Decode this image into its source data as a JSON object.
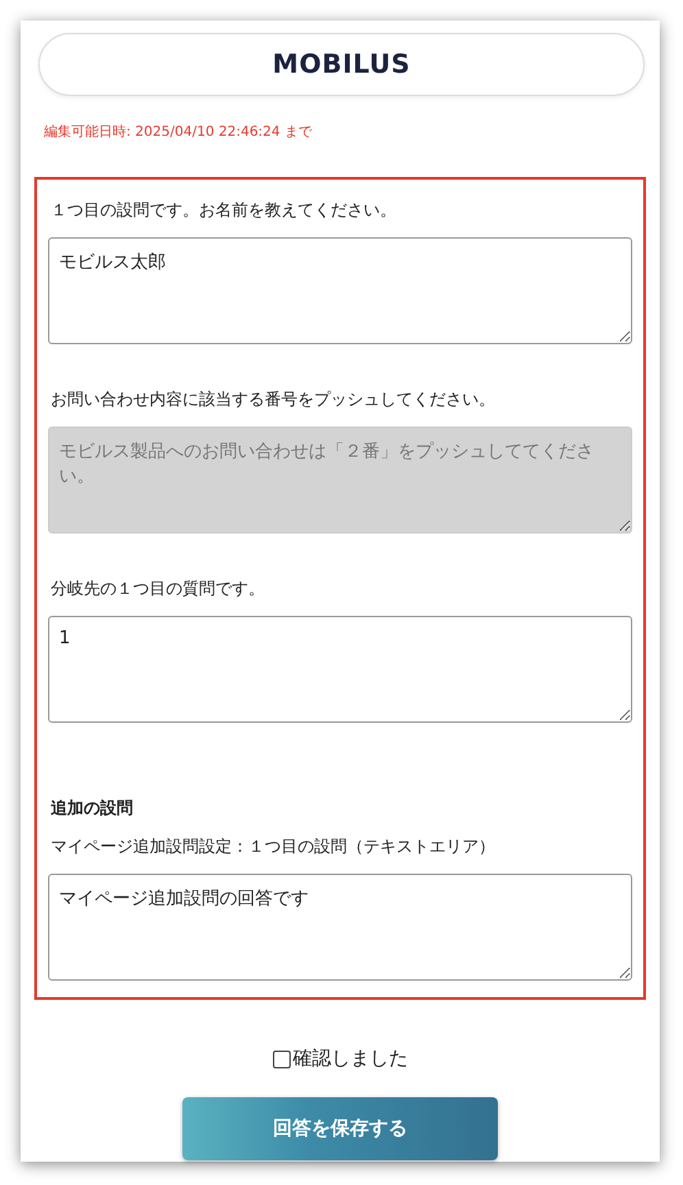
{
  "logo": "MOBILUS",
  "deadline": "編集可能日時: 2025/04/10 22:46:24 まで",
  "questions": [
    {
      "label": "１つ目の設問です。お名前を教えてください。",
      "value": "モビルス太郎",
      "disabled": false
    },
    {
      "label": "お問い合わせ内容に該当する番号をプッシュしてください。",
      "value": "モビルス製品へのお問い合わせは「２番」をプッシュしててください。",
      "disabled": true
    },
    {
      "label": "分岐先の１つ目の質問です。",
      "value": "1",
      "disabled": false
    }
  ],
  "additional": {
    "heading": "追加の設問",
    "label": "マイページ追加設問設定：１つ目の設問（テキストエリア）",
    "value": "マイページ追加設問の回答です",
    "disabled": false
  },
  "confirm": {
    "label": "確認しました",
    "checked": false
  },
  "save_button": "回答を保存する"
}
